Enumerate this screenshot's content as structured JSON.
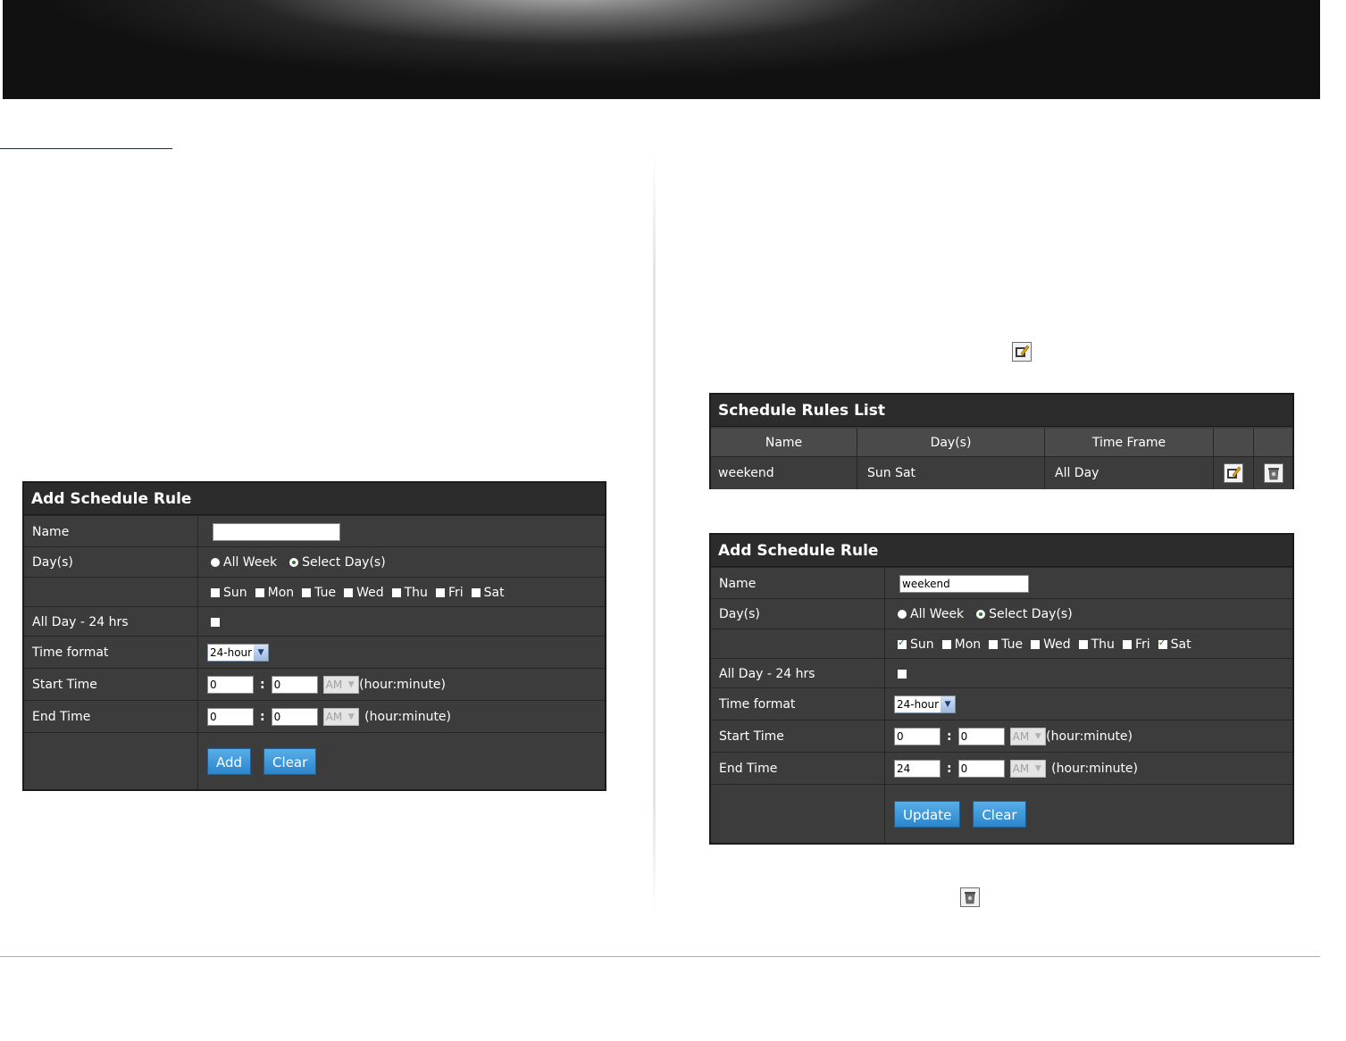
{
  "left_panel": {
    "title": "Add Schedule Rule",
    "name_label": "Name",
    "name_value": "",
    "days_label": "Day(s)",
    "all_week": "All Week",
    "select_days": "Select Day(s)",
    "days": [
      {
        "label": "Sun",
        "checked": false
      },
      {
        "label": "Mon",
        "checked": false
      },
      {
        "label": "Tue",
        "checked": false
      },
      {
        "label": "Wed",
        "checked": false
      },
      {
        "label": "Thu",
        "checked": false
      },
      {
        "label": "Fri",
        "checked": false
      },
      {
        "label": "Sat",
        "checked": false
      }
    ],
    "allday_label": "All Day - 24 hrs",
    "timeformat_label": "Time format",
    "timeformat_value": "24-hour",
    "start_label": "Start Time",
    "start_hour": "0",
    "start_minute": "0",
    "end_label": "End Time",
    "end_hour": "0",
    "end_minute": "0",
    "ampm": "AM",
    "hint": "(hour:minute)",
    "add_btn": "Add",
    "clear_btn": "Clear"
  },
  "rules_list": {
    "title": "Schedule Rules List",
    "headers": [
      "Name",
      "Day(s)",
      "Time Frame"
    ],
    "rows": [
      {
        "name": "weekend",
        "days": "Sun Sat",
        "time_frame": "All Day"
      }
    ]
  },
  "right_panel": {
    "title": "Add Schedule Rule",
    "name_label": "Name",
    "name_value": "weekend",
    "days_label": "Day(s)",
    "all_week": "All Week",
    "select_days": "Select Day(s)",
    "days": [
      {
        "label": "Sun",
        "checked": true
      },
      {
        "label": "Mon",
        "checked": false
      },
      {
        "label": "Tue",
        "checked": false
      },
      {
        "label": "Wed",
        "checked": false
      },
      {
        "label": "Thu",
        "checked": false
      },
      {
        "label": "Fri",
        "checked": false
      },
      {
        "label": "Sat",
        "checked": true
      }
    ],
    "allday_label": "All Day - 24 hrs",
    "timeformat_label": "Time format",
    "timeformat_value": "24-hour",
    "start_label": "Start Time",
    "start_hour": "0",
    "start_minute": "0",
    "end_label": "End Time",
    "end_hour": "24",
    "end_minute": "0",
    "ampm": "AM",
    "hint": "(hour:minute)",
    "update_btn": "Update",
    "clear_btn": "Clear"
  },
  "icons": {
    "edit": "edit-icon",
    "delete": "trash-icon"
  },
  "colors": {
    "panel_bg": "#3c3c3c",
    "title_bg": "#2c2c2c",
    "button": "#2b85cc",
    "footer_rule": "#8fb4cc"
  }
}
